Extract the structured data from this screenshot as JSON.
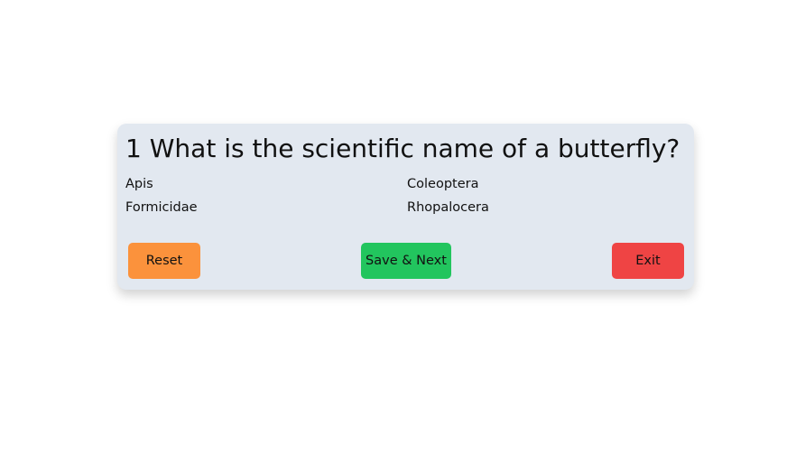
{
  "quiz": {
    "question_number": "1",
    "question_text": "What is the scientific name of a butterfly?",
    "options": [
      "Apis",
      "Coleoptera",
      "Formicidae",
      "Rhopalocera"
    ]
  },
  "buttons": {
    "reset_label": "Reset",
    "save_next_label": "Save & Next",
    "exit_label": "Exit"
  },
  "colors": {
    "card_background": "#e2e8f0",
    "reset": "#fb923c",
    "save_next": "#22c55e",
    "exit": "#ef4444"
  }
}
